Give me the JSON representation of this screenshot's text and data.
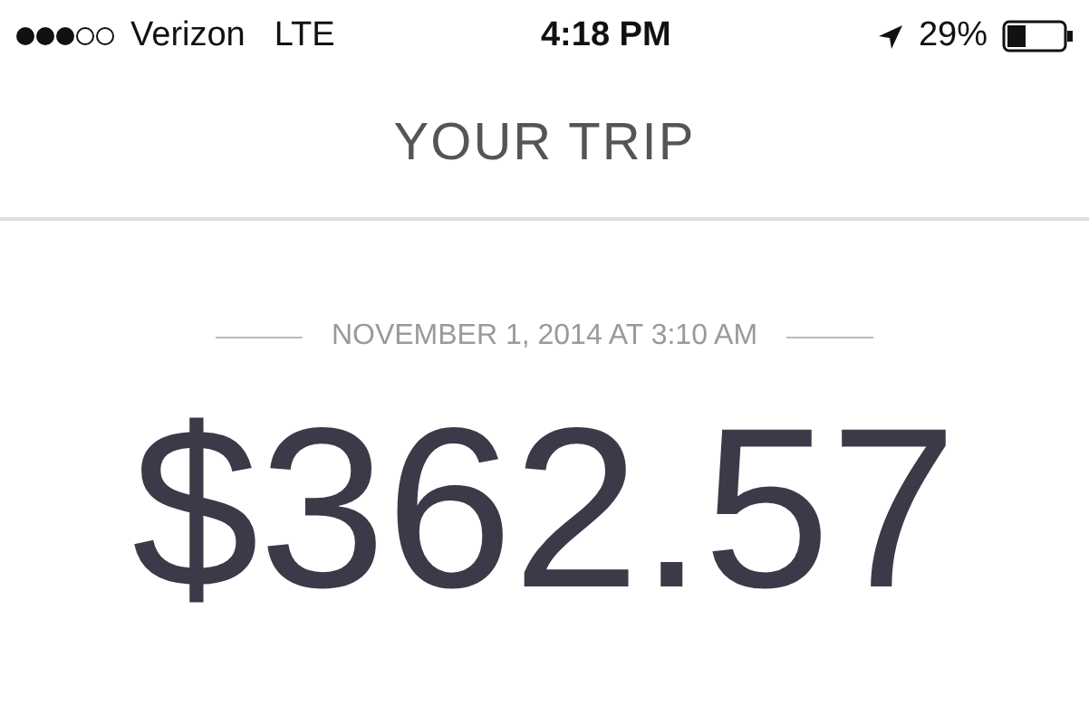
{
  "status_bar": {
    "carrier": "Verizon",
    "network": "LTE",
    "time": "4:18 PM",
    "battery_percent": "29%"
  },
  "header": {
    "title": "YOUR TRIP"
  },
  "trip": {
    "date": "NOVEMBER 1, 2014 AT 3:10 AM",
    "fare": "$362.57"
  }
}
